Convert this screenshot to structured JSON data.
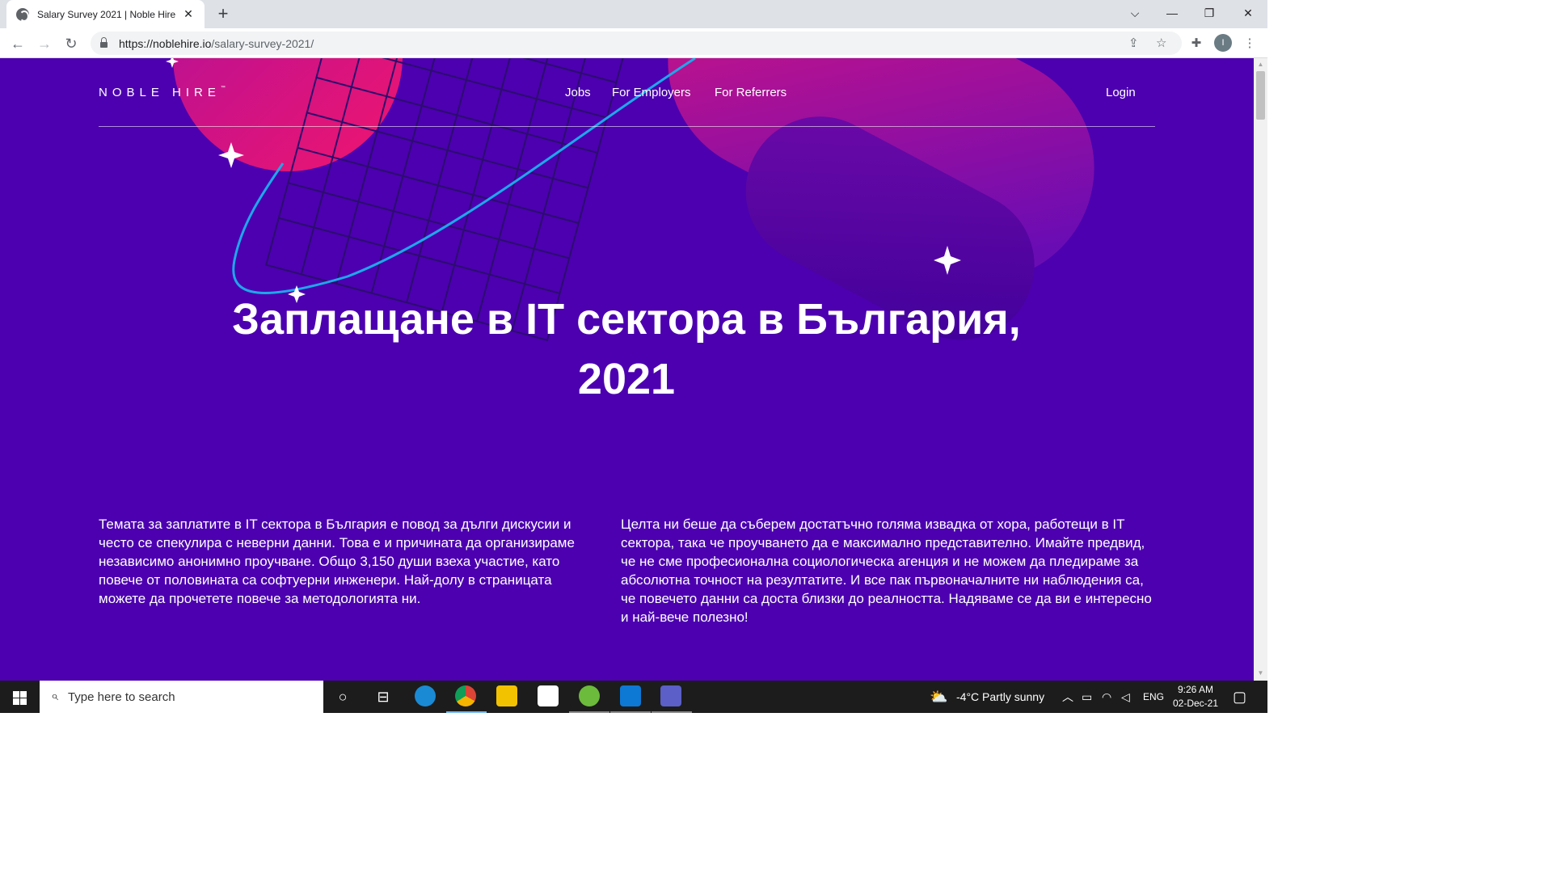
{
  "browser": {
    "tab_title": "Salary Survey 2021 | Noble Hire",
    "tab_close": "✕",
    "new_tab": "+",
    "url_host": "https://noblehire.io",
    "url_path": "/salary-survey-2021/",
    "profile_initial": "I"
  },
  "site": {
    "logo": "NOBLE HIRE",
    "logo_mark": "™",
    "nav": {
      "jobs": "Jobs",
      "employers": "For Employers",
      "referrers": "For Referrers",
      "login": "Login"
    },
    "hero_title": "Заплащане в IT сектора в България, 2021",
    "intro_left": "Темата за заплатите в IT сектора в България е повод за дълги дискусии и често се спекулира с неверни данни. Това е и причината да организираме независимо анонимно проучване. Общо 3,150 души взеха участие, като повече от половината са софтуерни инженери. Най-долу в страницата можете да прочетете повече за методологията ни.",
    "intro_right": "Целта ни беше да съберем достатъчно голяма извадка от хора, работещи в IT сектора, така че проучването да е максимално представително. Имайте предвид, че не сме професионална социологическа агенция и не можем да плeдираме за абсолютна точност на резултатите. И все пак първоначалните ни наблюдения са, че повечето данни са доста близки до реалността. Надяваме се да ви е интересно и най-вече полезно!"
  },
  "taskbar": {
    "search_placeholder": "Type here to search",
    "weather": "-4°C  Partly sunny",
    "language": "ENG",
    "time": "9:26 AM",
    "date": "02-Dec-21"
  },
  "colors": {
    "page_bg": "#4c00b0",
    "accent_pink": "#e0107a",
    "accent_blue": "#2aa3e6"
  }
}
